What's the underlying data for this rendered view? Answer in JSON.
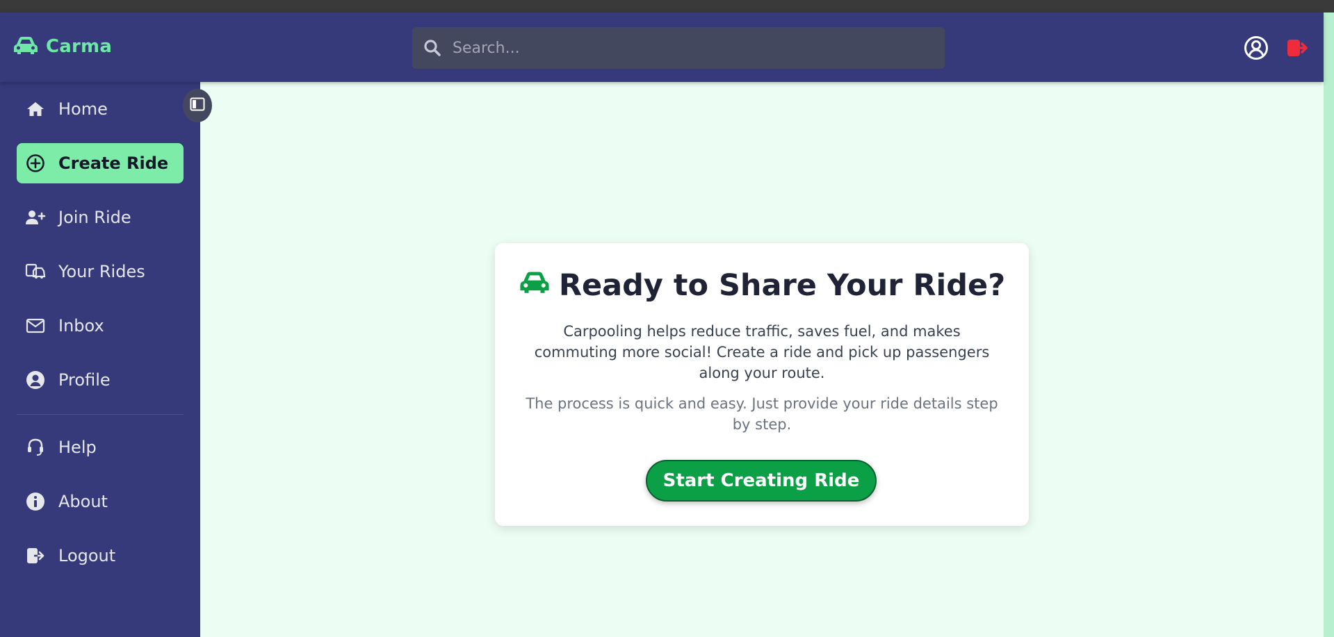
{
  "header": {
    "brand_name": "Carma",
    "search_placeholder": "Search...",
    "icons": [
      "car-icon",
      "search-icon",
      "user-circle-icon",
      "logout-red-icon"
    ],
    "colors": {
      "header_bg": "#363a7a",
      "brand": "#6ee7a7",
      "logout": "#ef2b3c"
    }
  },
  "sidebar": {
    "items": [
      {
        "label": "Home",
        "icon": "home-icon"
      },
      {
        "label": "Create Ride",
        "icon": "plus-circle-icon",
        "active": true
      },
      {
        "label": "Join Ride",
        "icon": "user-plus-icon"
      },
      {
        "label": "Your Rides",
        "icon": "rides-icon"
      },
      {
        "label": "Inbox",
        "icon": "envelope-icon"
      },
      {
        "label": "Profile",
        "icon": "user-icon"
      },
      {
        "label": "Help",
        "icon": "headset-icon"
      },
      {
        "label": "About",
        "icon": "info-icon"
      },
      {
        "label": "Logout",
        "icon": "logout-icon"
      }
    ],
    "colors": {
      "bg": "#363a7a",
      "active_bg": "#7deca8"
    }
  },
  "main": {
    "card": {
      "title": "Ready to Share Your Ride?",
      "paragraph1": "Carpooling helps reduce traffic, saves fuel, and makes commuting more social! Create a ride and pick up passengers along your route.",
      "paragraph2": "The process is quick and easy. Just provide your ride details step by step.",
      "button_label": "Start Creating Ride",
      "colors": {
        "accent": "#0ca046",
        "title": "#1f2335"
      }
    }
  }
}
